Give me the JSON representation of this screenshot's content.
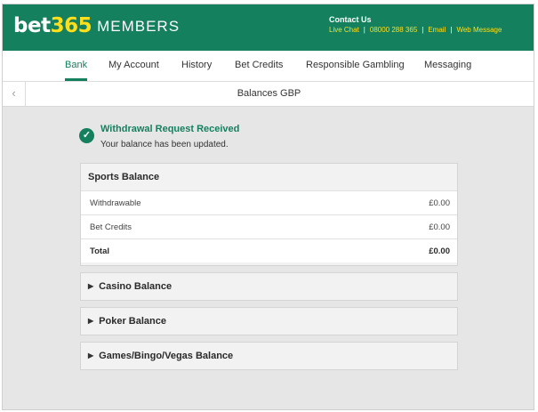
{
  "header": {
    "logo_bet": "bet",
    "logo_num": "365",
    "logo_members": "MEMBERS",
    "contact_title": "Contact Us",
    "contact_links": [
      "Live Chat",
      "08000 288 365",
      "Email",
      "Web Message"
    ],
    "separator": "|",
    "brand_color": "#14805e",
    "accent_color": "#ffdf1b"
  },
  "nav": {
    "items": [
      {
        "label": "Bank",
        "active": true
      },
      {
        "label": "My Account",
        "active": false
      },
      {
        "label": "History",
        "active": false
      },
      {
        "label": "Bet Credits",
        "active": false
      },
      {
        "label": "Responsible Gambling",
        "active": false
      },
      {
        "label": "Messaging",
        "active": false
      }
    ]
  },
  "subheader": {
    "back_icon": "chevron-left-icon",
    "back_glyph": "‹",
    "title": "Balances GBP"
  },
  "notice": {
    "icon": "check-circle-icon",
    "icon_glyph": "✓",
    "title": "Withdrawal Request Received",
    "message": "Your balance has been updated."
  },
  "balances": {
    "sports": {
      "title": "Sports Balance",
      "rows": [
        {
          "label": "Withdrawable",
          "value": "£0.00"
        },
        {
          "label": "Bet Credits",
          "value": "£0.00"
        },
        {
          "label": "Total",
          "value": "£0.00"
        }
      ]
    },
    "collapsed_icon": "triangle-right-icon",
    "collapsed_glyph": "▶",
    "casino_title": "Casino Balance",
    "poker_title": "Poker Balance",
    "games_title": "Games/Bingo/Vegas Balance"
  }
}
